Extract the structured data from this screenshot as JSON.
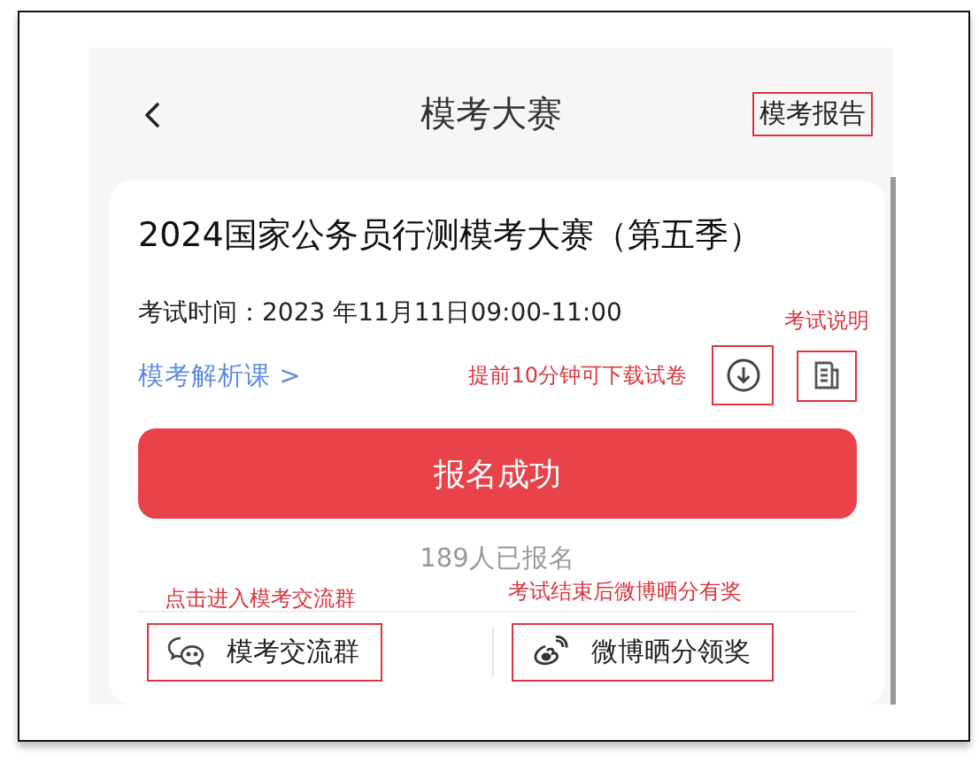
{
  "header": {
    "title": "模考大赛",
    "report": {
      "label": "模考报告",
      "highlighted": true
    }
  },
  "card": {
    "title": "2024国家公务员行测模考大赛（第五季）",
    "exam_time": "考试时间：2023 年11月11日09:00-11:00",
    "course_link": "模考解析课 >",
    "download": {
      "note": "提前10分钟可下载试卷",
      "highlighted": true
    },
    "instructions": {
      "note": "考试说明",
      "highlighted": true
    },
    "register_button": "报名成功",
    "registered_count": "189人已报名",
    "actions": [
      {
        "kind": "wechat",
        "label": "模考交流群",
        "note": "点击进入模考交流群",
        "highlighted": true
      },
      {
        "kind": "weibo",
        "label": "微博晒分领奖",
        "note": "考试结束后微博晒分有奖",
        "highlighted": true
      }
    ]
  }
}
